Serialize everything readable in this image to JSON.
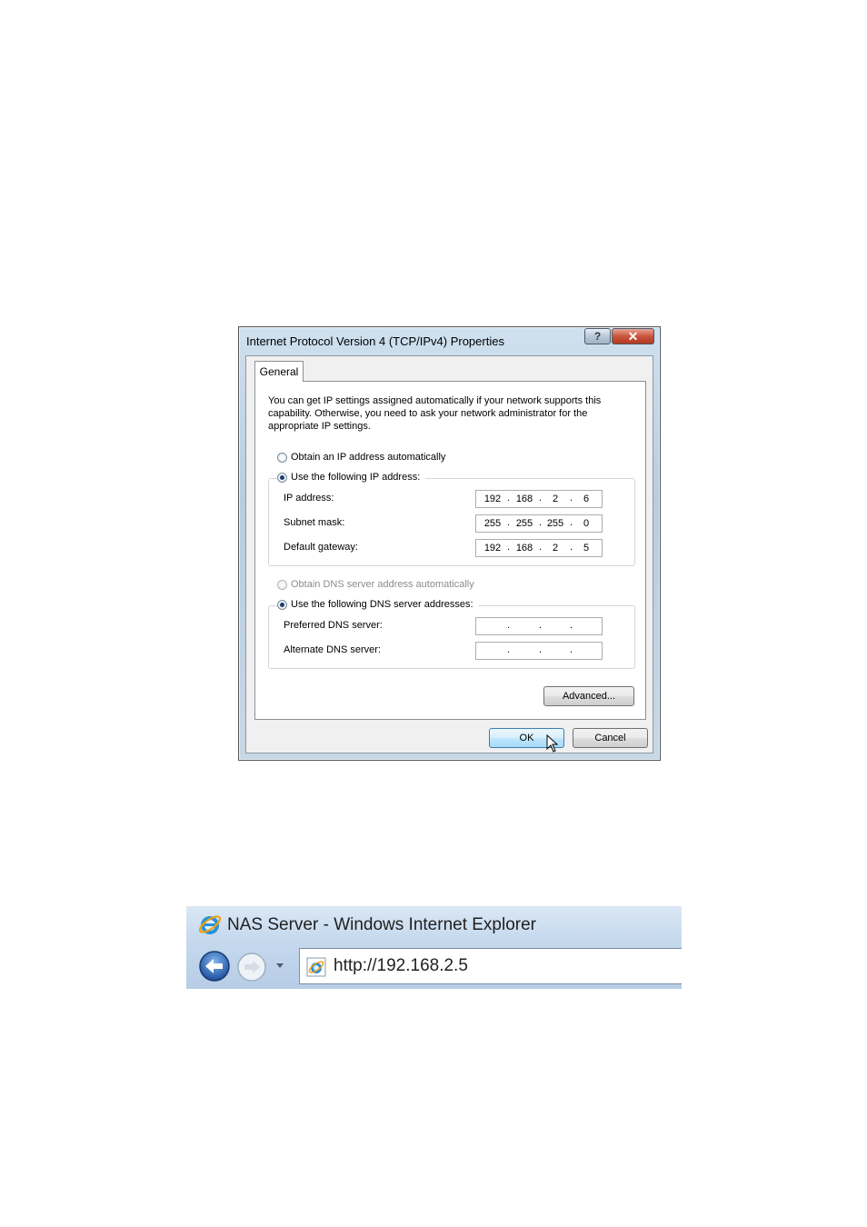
{
  "dialog": {
    "title": "Internet Protocol Version 4 (TCP/IPv4) Properties",
    "help_label": "?",
    "close_label": "✕",
    "tab_label": "General",
    "description": "You can get IP settings assigned automatically if your network supports this capability. Otherwise, you need to ask your network administrator for the appropriate IP settings.",
    "ip_section": {
      "auto_option": "Obtain an IP address automatically",
      "manual_option": "Use the following IP address:",
      "selected": "manual",
      "fields": [
        {
          "label": "IP address:",
          "octets": [
            "192",
            "168",
            "2",
            "6"
          ]
        },
        {
          "label": "Subnet mask:",
          "octets": [
            "255",
            "255",
            "255",
            "0"
          ]
        },
        {
          "label": "Default gateway:",
          "octets": [
            "192",
            "168",
            "2",
            "5"
          ]
        }
      ]
    },
    "dns_section": {
      "auto_option": "Obtain DNS server address automatically",
      "manual_option": "Use the following DNS server addresses:",
      "selected": "manual",
      "fields": [
        {
          "label": "Preferred DNS server:",
          "octets": [
            "",
            "",
            "",
            ""
          ]
        },
        {
          "label": "Alternate DNS server:",
          "octets": [
            "",
            "",
            "",
            ""
          ]
        }
      ]
    },
    "advanced_label": "Advanced...",
    "ok_label": "OK",
    "cancel_label": "Cancel"
  },
  "browser": {
    "title": "NAS Server - Windows Internet Explorer",
    "address": "http://192.168.2.5",
    "icons": [
      "ie-logo-icon",
      "back-arrow-icon",
      "forward-arrow-icon",
      "history-dropdown-icon",
      "page-icon"
    ]
  }
}
